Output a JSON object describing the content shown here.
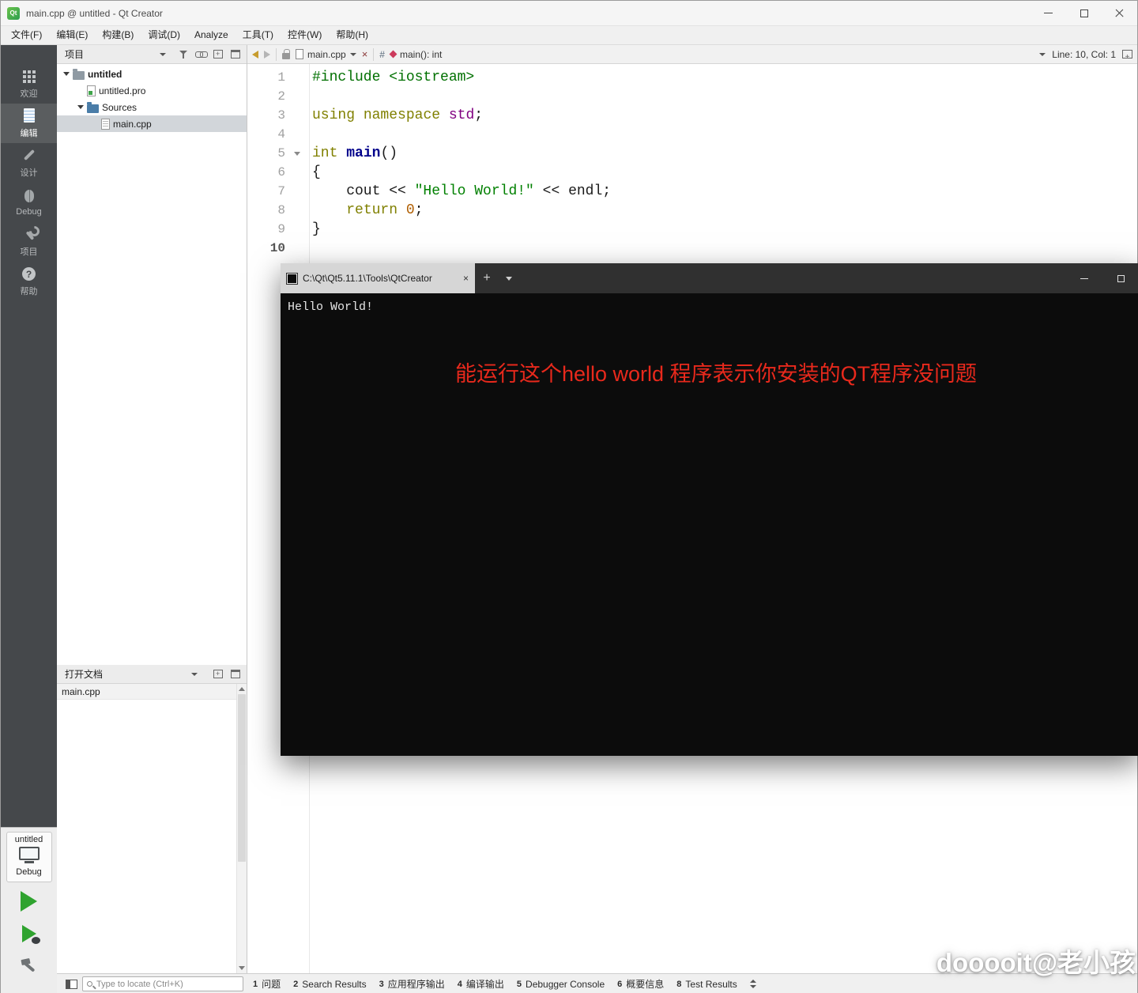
{
  "titlebar": {
    "title": "main.cpp @ untitled - Qt Creator"
  },
  "menubar": {
    "items": [
      "文件(F)",
      "编辑(E)",
      "构建(B)",
      "调试(D)",
      "Analyze",
      "工具(T)",
      "控件(W)",
      "帮助(H)"
    ]
  },
  "modebar": {
    "items": [
      {
        "name": "welcome",
        "label": "欢迎",
        "icon": "grid-icon",
        "active": false
      },
      {
        "name": "edit",
        "label": "编辑",
        "icon": "document-icon",
        "active": true
      },
      {
        "name": "design",
        "label": "设计",
        "icon": "pencil-icon",
        "active": false
      },
      {
        "name": "debug",
        "label": "Debug",
        "icon": "bug-icon",
        "active": false
      },
      {
        "name": "projects",
        "label": "项目",
        "icon": "wrench-icon",
        "active": false
      },
      {
        "name": "help",
        "label": "帮助",
        "icon": "help-icon",
        "active": false
      }
    ],
    "kit": {
      "project": "untitled",
      "config": "Debug"
    }
  },
  "projects_panel": {
    "title": "项目",
    "tree": [
      {
        "label": "untitled",
        "depth": 0,
        "expander": true,
        "icon": "project-folder-icon",
        "bold": true,
        "selected": false
      },
      {
        "label": "untitled.pro",
        "depth": 1,
        "expander": false,
        "icon": "pro-file-icon",
        "bold": false,
        "selected": false
      },
      {
        "label": "Sources",
        "depth": 1,
        "expander": true,
        "icon": "sources-folder-icon",
        "bold": false,
        "selected": false
      },
      {
        "label": "main.cpp",
        "depth": 2,
        "expander": false,
        "icon": "cpp-file-icon",
        "bold": false,
        "selected": true
      }
    ]
  },
  "opendocs_panel": {
    "title": "打开文档",
    "items": [
      "main.cpp"
    ]
  },
  "editor": {
    "toolbar": {
      "file": "main.cpp",
      "hash": "#",
      "symbol": "main(): int",
      "line_col": "Line: 10, Col: 1"
    },
    "code": [
      {
        "n": 1,
        "tokens": [
          {
            "t": "#include ",
            "c": "pp"
          },
          {
            "t": "<iostream>",
            "c": "pp"
          }
        ]
      },
      {
        "n": 2,
        "tokens": []
      },
      {
        "n": 3,
        "tokens": [
          {
            "t": "using",
            "c": "kw"
          },
          {
            "t": " ",
            "c": "pl"
          },
          {
            "t": "namespace",
            "c": "kw"
          },
          {
            "t": " ",
            "c": "pl"
          },
          {
            "t": "std",
            "c": "ty"
          },
          {
            "t": ";",
            "c": "pl"
          }
        ]
      },
      {
        "n": 4,
        "tokens": []
      },
      {
        "n": 5,
        "fold": true,
        "tokens": [
          {
            "t": "int",
            "c": "kw"
          },
          {
            "t": " ",
            "c": "pl"
          },
          {
            "t": "main",
            "c": "fn"
          },
          {
            "t": "()",
            "c": "pl"
          }
        ]
      },
      {
        "n": 6,
        "tokens": [
          {
            "t": "{",
            "c": "pl"
          }
        ]
      },
      {
        "n": 7,
        "tokens": [
          {
            "t": "    cout << ",
            "c": "pl"
          },
          {
            "t": "\"Hello World!\"",
            "c": "str"
          },
          {
            "t": " << endl;",
            "c": "pl"
          }
        ]
      },
      {
        "n": 8,
        "tokens": [
          {
            "t": "    ",
            "c": "pl"
          },
          {
            "t": "return",
            "c": "kw"
          },
          {
            "t": " ",
            "c": "pl"
          },
          {
            "t": "0",
            "c": "num"
          },
          {
            "t": ";",
            "c": "pl"
          }
        ]
      },
      {
        "n": 9,
        "tokens": [
          {
            "t": "}",
            "c": "pl"
          }
        ]
      },
      {
        "n": 10,
        "cur": true,
        "tokens": []
      }
    ]
  },
  "console": {
    "tab_title": "C:\\Qt\\Qt5.11.1\\Tools\\QtCreator",
    "output": "Hello World!",
    "annotation": "能运行这个hello world 程序表示你安装的QT程序没问题",
    "annotation_color": "#e8291c"
  },
  "statusbar": {
    "locator_placeholder": "Type to locate (Ctrl+K)",
    "panes": [
      {
        "num": "1",
        "label": "问题"
      },
      {
        "num": "2",
        "label": "Search Results"
      },
      {
        "num": "3",
        "label": "应用程序输出"
      },
      {
        "num": "4",
        "label": "编译输出"
      },
      {
        "num": "5",
        "label": "Debugger Console"
      },
      {
        "num": "6",
        "label": "概要信息"
      },
      {
        "num": "8",
        "label": "Test Results"
      }
    ]
  },
  "watermark": "dooooit@老小孩",
  "colors": {
    "run_green": "#2fa32f",
    "annotation_red": "#e8291c",
    "modebar_bg": "#45484b",
    "console_bg": "#0c0c0c",
    "syntax_keyword": "#808000",
    "syntax_string": "#008000",
    "syntax_preprocessor": "#007000",
    "syntax_type": "#800080",
    "syntax_function": "#00008b",
    "syntax_number": "#b05e00",
    "selection_gray": "#d2d6da"
  }
}
